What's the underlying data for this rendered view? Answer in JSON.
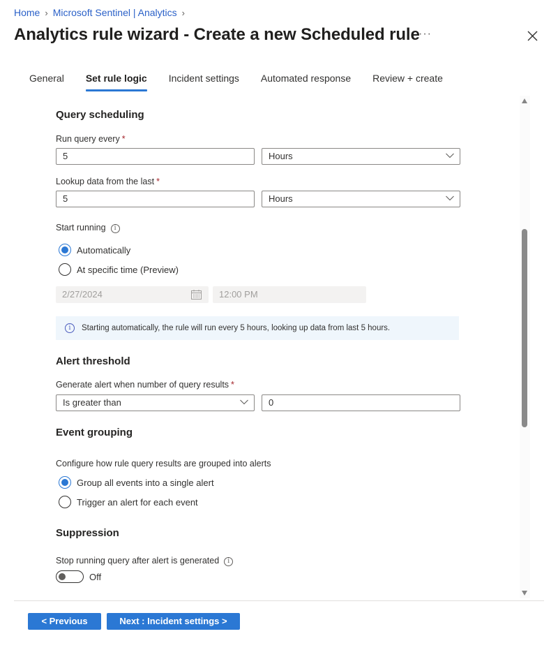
{
  "breadcrumb": [
    {
      "label": "Home"
    },
    {
      "label": "Microsoft Sentinel | Analytics"
    }
  ],
  "header": {
    "title": "Analytics rule wizard - Create a new Scheduled rule",
    "more_label": "···"
  },
  "tabs": [
    {
      "label": "General",
      "active": false
    },
    {
      "label": "Set rule logic",
      "active": true
    },
    {
      "label": "Incident settings",
      "active": false
    },
    {
      "label": "Automated response",
      "active": false
    },
    {
      "label": "Review + create",
      "active": false
    }
  ],
  "query_scheduling": {
    "heading": "Query scheduling",
    "run_every": {
      "label": "Run query every",
      "value": "5",
      "unit": "Hours"
    },
    "lookup": {
      "label": "Lookup data from the last",
      "value": "5",
      "unit": "Hours"
    },
    "start_running": {
      "label": "Start running",
      "options": [
        {
          "label": "Automatically",
          "selected": true
        },
        {
          "label": "At specific time (Preview)",
          "selected": false
        }
      ],
      "date": "2/27/2024",
      "time": "12:00 PM"
    },
    "info_text": "Starting automatically, the rule will run every 5 hours, looking up data from last 5 hours."
  },
  "alert_threshold": {
    "heading": "Alert threshold",
    "label": "Generate alert when number of query results",
    "operator": "Is greater than",
    "value": "0"
  },
  "event_grouping": {
    "heading": "Event grouping",
    "description": "Configure how rule query results are grouped into alerts",
    "options": [
      {
        "label": "Group all events into a single alert",
        "selected": true
      },
      {
        "label": "Trigger an alert for each event",
        "selected": false
      }
    ]
  },
  "suppression": {
    "heading": "Suppression",
    "label": "Stop running query after alert is generated",
    "toggle_state": "Off"
  },
  "footer": {
    "previous_label": "< Previous",
    "next_label": "Next : Incident settings >"
  },
  "required_marker": "*",
  "info_glyph": "i",
  "colors": {
    "accent": "#2b78d4",
    "link": "#2b61c8",
    "info_bg": "#eff6fc"
  }
}
